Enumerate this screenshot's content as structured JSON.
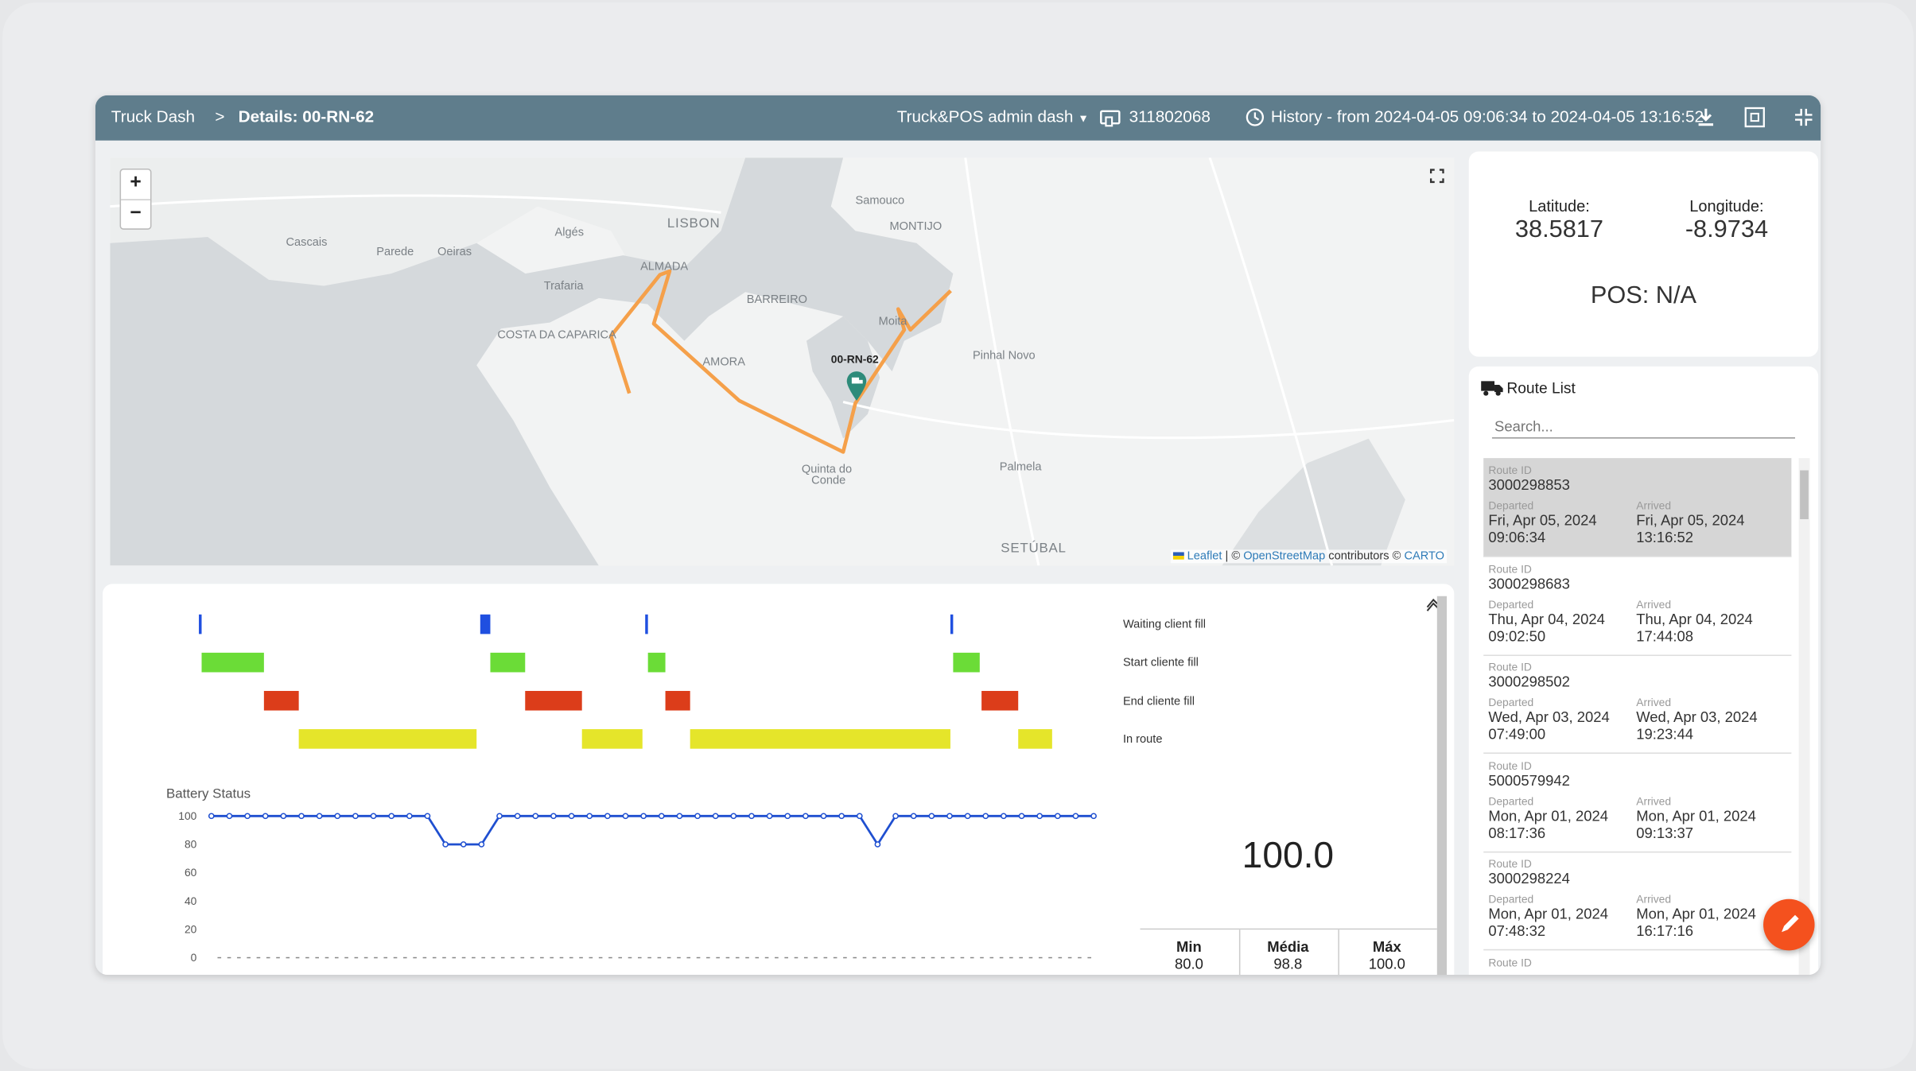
{
  "header": {
    "breadcrumb_root": "Truck Dash",
    "breadcrumb_sep": ">",
    "breadcrumb_current": "Details: 00-RN-62",
    "dashboard_select": "Truck&POS admin dash",
    "device_id": "311802068",
    "history": "History - from 2024-04-05 09:06:34 to 2024-04-05 13:16:52",
    "color": "#5f7d8c"
  },
  "map": {
    "zoom_in": "+",
    "zoom_out": "−",
    "vehicle_label": "00-RN-62",
    "places": [
      "LISBON",
      "MONTIJO",
      "Samouco",
      "Algés",
      "Cascais",
      "Parede",
      "Oeiras",
      "ALMADA",
      "Trafaria",
      "BARREIRO",
      "COSTA DA CAPARICA",
      "AMORA",
      "Moita",
      "Pinhal Novo",
      "Quinta do",
      "Conde",
      "Palmela",
      "SETÚBAL"
    ],
    "attribution": {
      "leaflet": "Leaflet",
      "sep": "| ©",
      "osm": "OpenStreetMap",
      "contrib": "contributors ©",
      "carto": "CARTO"
    },
    "route_color": "#f5a04a",
    "marker_color": "#2e8b7a"
  },
  "position": {
    "lat_label": "Latitude:",
    "lat": "38.5817",
    "lon_label": "Longitude:",
    "lon": "-8.9734",
    "pos": "POS: N/A"
  },
  "route_list": {
    "title": "Route List",
    "search_placeholder": "Search...",
    "id_label": "Route ID",
    "departed_label": "Departed",
    "arrived_label": "Arrived",
    "routes": [
      {
        "id": "3000298853",
        "dep_date": "Fri, Apr 05, 2024",
        "dep_time": "09:06:34",
        "arr_date": "Fri, Apr 05, 2024",
        "arr_time": "13:16:52",
        "selected": true
      },
      {
        "id": "3000298683",
        "dep_date": "Thu, Apr 04, 2024",
        "dep_time": "09:02:50",
        "arr_date": "Thu, Apr 04, 2024",
        "arr_time": "17:44:08"
      },
      {
        "id": "3000298502",
        "dep_date": "Wed, Apr 03, 2024",
        "dep_time": "07:49:00",
        "arr_date": "Wed, Apr 03, 2024",
        "arr_time": "19:23:44"
      },
      {
        "id": "5000579942",
        "dep_date": "Mon, Apr 01, 2024",
        "dep_time": "08:17:36",
        "arr_date": "Mon, Apr 01, 2024",
        "arr_time": "09:13:37"
      },
      {
        "id": "3000298224",
        "dep_date": "Mon, Apr 01, 2024",
        "dep_time": "07:48:32",
        "arr_date": "Mon, Apr 01, 2024",
        "arr_time": "16:17:16"
      }
    ],
    "fab_color": "#f4511e"
  },
  "chart_data": [
    {
      "type": "timeline",
      "rows": [
        {
          "name": "Waiting client fill",
          "color": "#1f4fe0",
          "segments": [
            [
              0.1,
              0.4
            ],
            [
              30.8,
              31.9
            ],
            [
              48.8,
              49.1
            ],
            [
              82.1,
              82.4
            ]
          ]
        },
        {
          "name": "Start cliente fill",
          "color": "#6bdc37",
          "segments": [
            [
              0.4,
              7.2
            ],
            [
              31.9,
              35.7
            ],
            [
              49.1,
              51.0
            ],
            [
              82.4,
              85.3
            ]
          ]
        },
        {
          "name": "End cliente fill",
          "color": "#dc3d1a",
          "segments": [
            [
              7.2,
              11.0
            ],
            [
              35.7,
              41.9
            ],
            [
              51.0,
              53.7
            ],
            [
              85.5,
              89.5
            ]
          ]
        },
        {
          "name": "In route",
          "color": "#e5e52a",
          "segments": [
            [
              11.0,
              30.4
            ],
            [
              41.9,
              48.5
            ],
            [
              53.7,
              82.1
            ],
            [
              89.5,
              93.2
            ]
          ]
        }
      ]
    },
    {
      "type": "line",
      "title": "Battery Status",
      "yticks": [
        0,
        20,
        40,
        60,
        80,
        100
      ],
      "ylim": [
        0,
        100
      ],
      "color": "#1f4fd0",
      "values": [
        100,
        100,
        100,
        100,
        100,
        100,
        100,
        100,
        100,
        100,
        100,
        100,
        100,
        80,
        80,
        80,
        100,
        100,
        100,
        100,
        100,
        100,
        100,
        100,
        100,
        100,
        100,
        100,
        100,
        100,
        100,
        100,
        100,
        100,
        100,
        100,
        100,
        80,
        100,
        100,
        100,
        100,
        100,
        100,
        100,
        100,
        100,
        100,
        100,
        100
      ]
    }
  ],
  "gauge": {
    "value": "100.0",
    "min_label": "Min",
    "min": "80.0",
    "avg_label": "Média",
    "avg": "98.8",
    "max_label": "Máx",
    "max": "100.0"
  }
}
